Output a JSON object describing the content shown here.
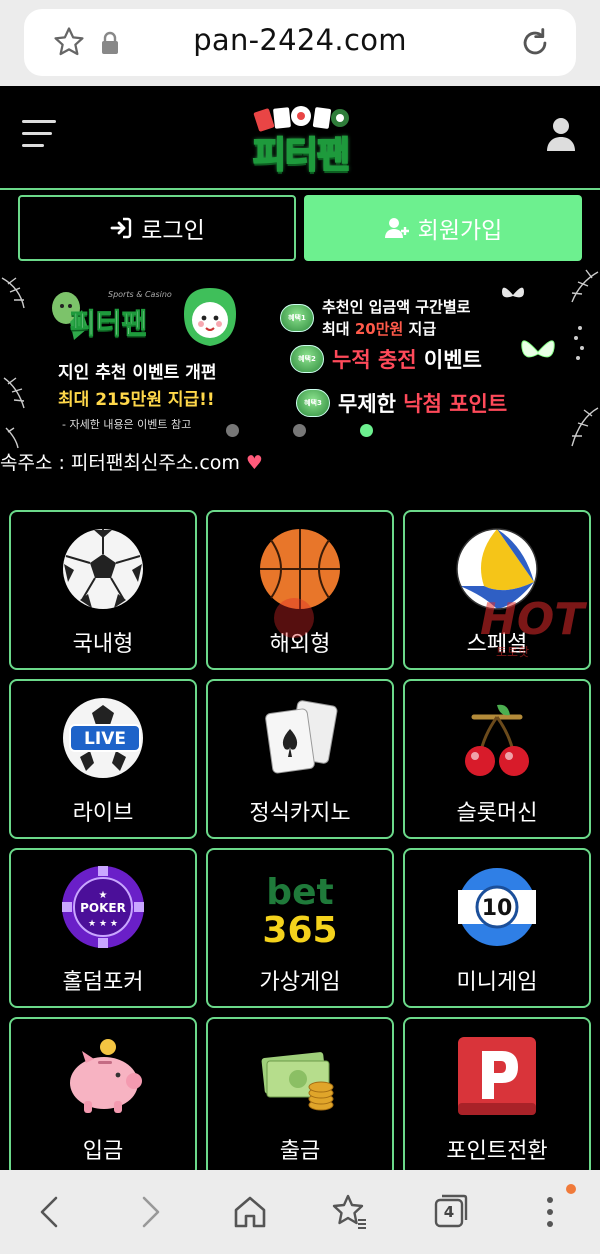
{
  "browser": {
    "url": "pan-2424.com",
    "tab_count": "4"
  },
  "header": {
    "logo_text": "피터팬"
  },
  "auth": {
    "login_label": "로그인",
    "signup_label": "회원가입"
  },
  "banner": {
    "promo_logo": "피터팬",
    "promo_logo_sub": "Sports & Casino",
    "line1": "지인 추천 이벤트 개편",
    "line2": "최대 215만원 지급!!",
    "note": "- 자세한 내용은 이벤트 참고",
    "benefits": [
      {
        "badge": "혜택1",
        "text_a": "추천인 입금액 구간별로",
        "text_b_pre": "최대 ",
        "text_b_hl": "20만원",
        "text_b_post": " 지급"
      },
      {
        "badge": "혜택2",
        "hl": "누적 충전",
        "text": " 이벤트"
      },
      {
        "badge": "혜택3",
        "text": "무제한 ",
        "hl": "낙첨 포인트"
      }
    ],
    "slide_count": 3,
    "active_slide": 3
  },
  "ticker": {
    "text": "속주소 : 피터팬최신주소.com",
    "emoji": "♥"
  },
  "menu": {
    "items": [
      {
        "label": "국내형",
        "icon": "soccer-ball-icon"
      },
      {
        "label": "해외형",
        "icon": "basketball-icon"
      },
      {
        "label": "스페셜",
        "icon": "volleyball-icon"
      },
      {
        "label": "라이브",
        "icon": "live-ball-icon"
      },
      {
        "label": "정식카지노",
        "icon": "playing-cards-icon"
      },
      {
        "label": "슬롯머신",
        "icon": "cherries-icon"
      },
      {
        "label": "홀덤포커",
        "icon": "poker-chip-icon"
      },
      {
        "label": "가상게임",
        "icon": "bet365-icon"
      },
      {
        "label": "미니게임",
        "icon": "lottery-ball-icon"
      },
      {
        "label": "입금",
        "icon": "piggy-bank-icon"
      },
      {
        "label": "출금",
        "icon": "cash-coins-icon"
      },
      {
        "label": "포인트전환",
        "icon": "parking-p-icon"
      }
    ]
  },
  "watermark": {
    "text": "HOT",
    "sub": "토토핫"
  },
  "colors": {
    "accent_green": "#6df08f",
    "border_green": "#6bd98a",
    "highlight_red": "#ff4a5a",
    "gold": "#ffd84a"
  }
}
